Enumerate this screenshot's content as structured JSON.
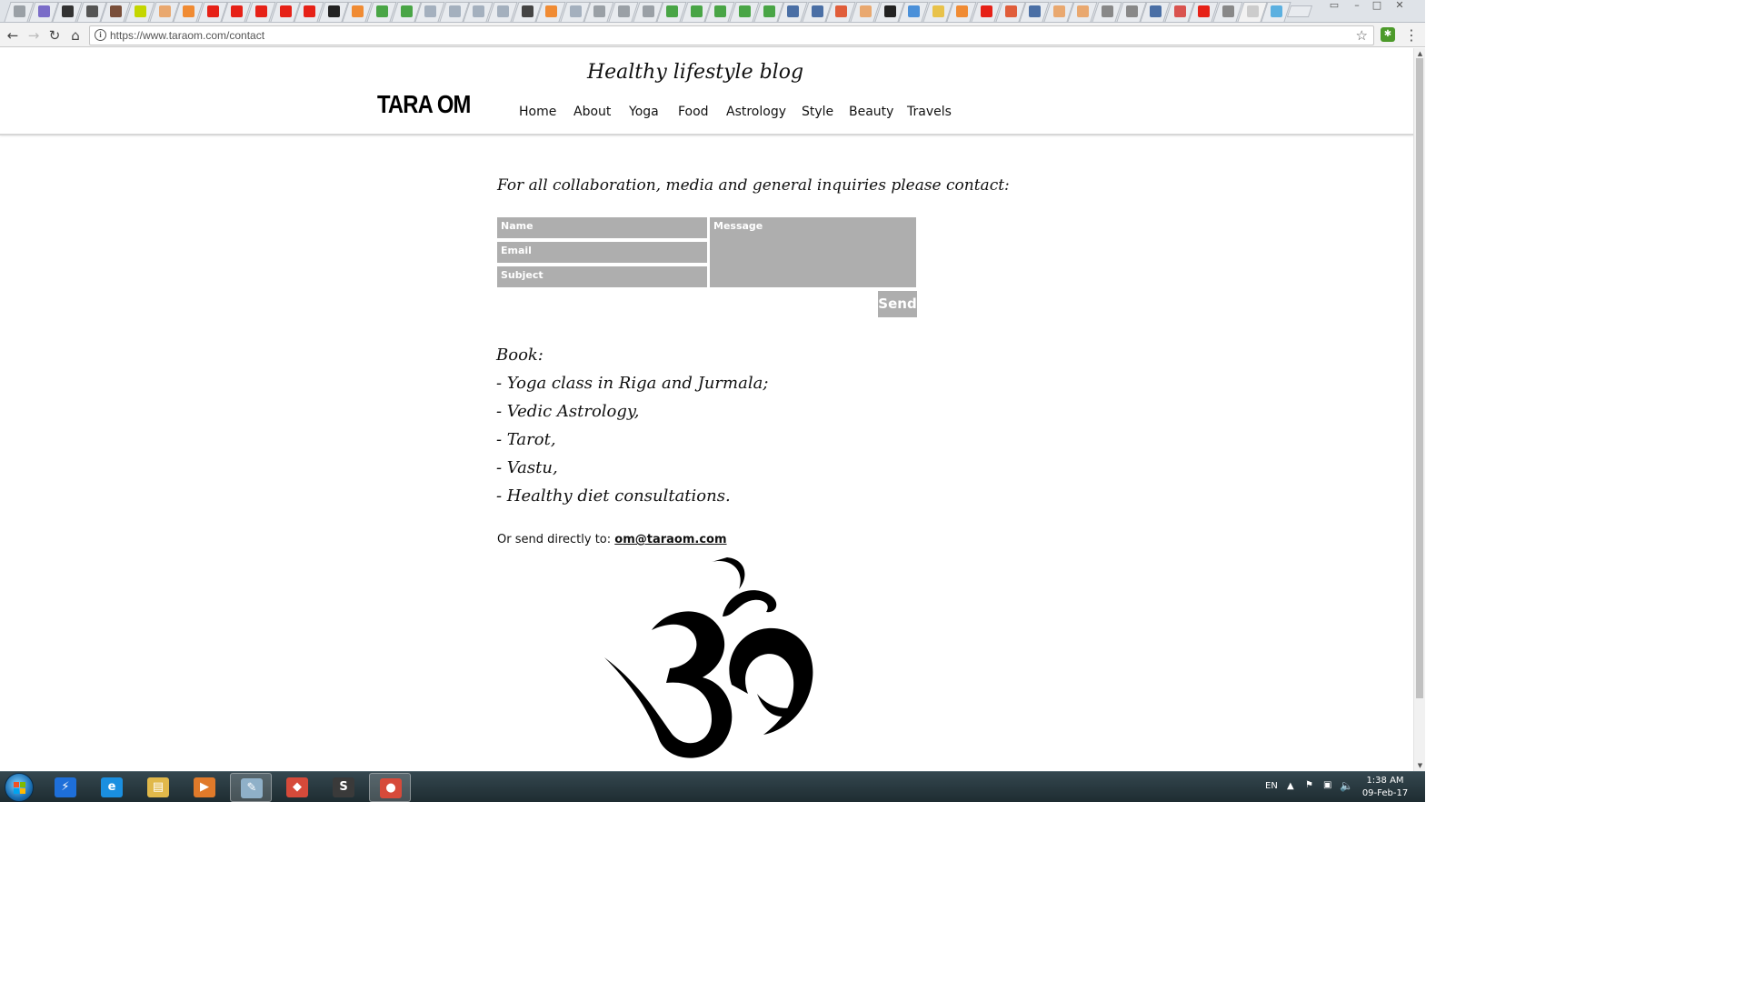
{
  "browser": {
    "url": "https://www.taraom.com/contact",
    "tab_icon_colors": [
      "#9aa0a6",
      "#7a6cc8",
      "#333333",
      "#555555",
      "#7a4f3a",
      "#c4d600",
      "#e9a86f",
      "#f08b33",
      "#e62117",
      "#e62117",
      "#e62117",
      "#e62117",
      "#e62117",
      "#222222",
      "#f08b33",
      "#49a546",
      "#49a546",
      "#a4b0be",
      "#a4b0be",
      "#a4b0be",
      "#a4b0be",
      "#444444",
      "#f08b33",
      "#a4b0be",
      "#9aa0a6",
      "#9aa0a6",
      "#9aa0a6",
      "#49a546",
      "#49a546",
      "#49a546",
      "#49a546",
      "#49a546",
      "#4a6fa5",
      "#4a6fa5",
      "#e05d3a",
      "#e9a86f",
      "#222222",
      "#4a90d9",
      "#e8c24a",
      "#f08b33",
      "#e62117",
      "#e05d3a",
      "#4a6fa5",
      "#e9a86f",
      "#e9a86f",
      "#888888",
      "#888888",
      "#4a6fa5",
      "#d9534f",
      "#e62117",
      "#888888",
      "#cccccc",
      "#5bb0e0"
    ]
  },
  "site": {
    "tagline": "Healthy lifestyle blog",
    "logo": "TARA OM",
    "nav": [
      "Home",
      "About",
      "Yoga",
      "Food",
      "Astrology",
      "Style",
      "Beauty",
      "Travels"
    ]
  },
  "contact": {
    "heading": "For all collaboration, media and general inquiries please contact:",
    "name_placeholder": "Name",
    "email_placeholder": "Email",
    "subject_placeholder": "Subject",
    "message_placeholder": "Message",
    "send_label": "Send"
  },
  "book": {
    "title": "Book:",
    "items": [
      "- Yoga class in Riga and Jurmala;",
      "- Vedic Astrology,",
      "- Tarot,",
      "- Vastu,",
      "- Healthy diet consultations."
    ]
  },
  "direct": {
    "label": "Or send directly to: ",
    "email": "om@taraom.com"
  },
  "taskbar": {
    "language": "EN",
    "time": "1:38 AM",
    "date": "09-Feb-17",
    "app_icons": [
      {
        "name": "flash-icon",
        "glyph": "⚡",
        "color": "#1e6fd9"
      },
      {
        "name": "internet-explorer-icon",
        "glyph": "e",
        "color": "#1a8fe0"
      },
      {
        "name": "file-explorer-icon",
        "glyph": "▤",
        "color": "#e0b84a"
      },
      {
        "name": "media-player-icon",
        "glyph": "▶",
        "color": "#e07a2a"
      },
      {
        "name": "notepad-icon",
        "glyph": "✎",
        "color": "#8fb0c8"
      },
      {
        "name": "colorful-app-icon",
        "glyph": "◆",
        "color": "#d64a3a"
      },
      {
        "name": "sublime-text-icon",
        "glyph": "S",
        "color": "#3a3a3a"
      },
      {
        "name": "chrome-icon",
        "glyph": "●",
        "color": "#d64a3a"
      }
    ]
  }
}
